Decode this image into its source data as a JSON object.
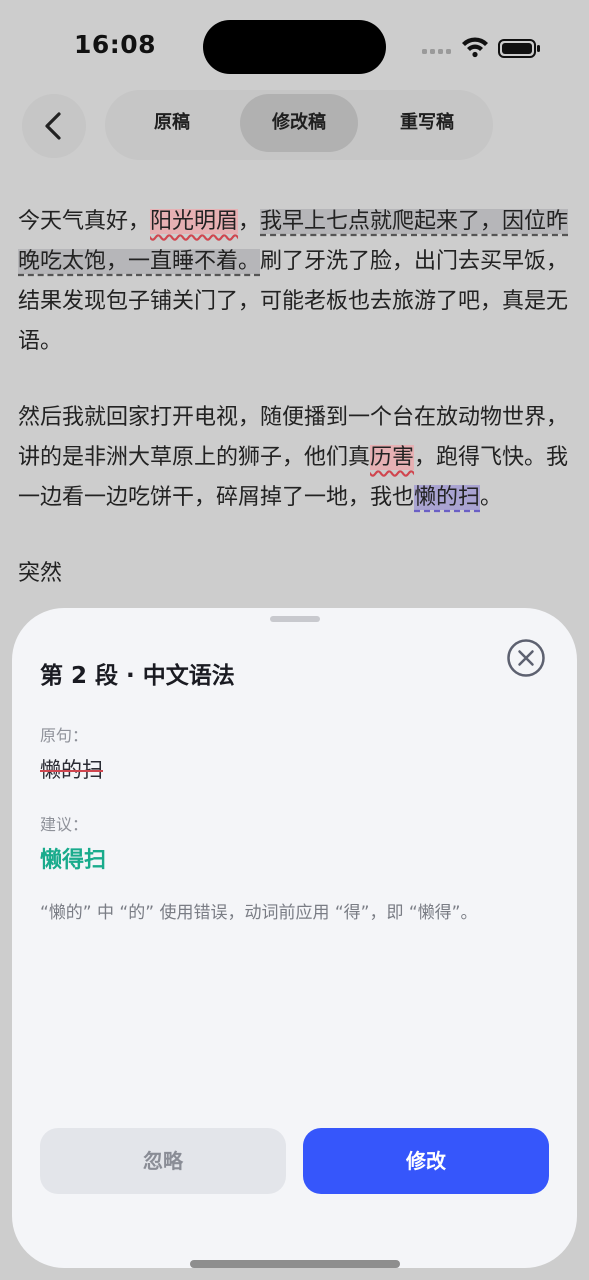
{
  "status_bar": {
    "time": "16:08"
  },
  "nav": {
    "tabs": [
      {
        "label": "原稿",
        "active": false
      },
      {
        "label": "修改稿",
        "active": true
      },
      {
        "label": "重写稿",
        "active": false
      }
    ]
  },
  "content": {
    "para1": {
      "t1": "今天气真好，",
      "h1": "阳光明眉",
      "t2": "，",
      "h2": "我早上七点就爬起来了，因位昨晚吃太饱，一直睡不着。",
      "t3": "刷了牙洗了脸，出门去买早饭，结果发现包子铺关门了，可能老板也去旅游了吧，真是无语。"
    },
    "para2": {
      "t1": "然后我就回家打开电视，随便播到一个台在放动物世界，讲的是非洲大草原上的狮子，他们真",
      "h1": "历害",
      "t2": "，跑得飞快。我一边看一边吃饼干，碎屑掉了一地，我也",
      "h2": "懒的扫",
      "t3": "。"
    },
    "para3": {
      "t1": "突然"
    }
  },
  "sheet": {
    "title": "第 2 段 · 中文语法",
    "original_label": "原句：",
    "original_text": "懒的扫",
    "suggest_label": "建议：",
    "suggest_text": "懒得扫",
    "explanation": "“懒的” 中 “的” 使用错误，动词前应用 “得”，即 “懒得”。",
    "ignore_label": "忽略",
    "fix_label": "修改"
  },
  "colors": {
    "accent": "#3656fb",
    "suggest_green": "#19ab8c",
    "error_red": "#d0464f"
  }
}
